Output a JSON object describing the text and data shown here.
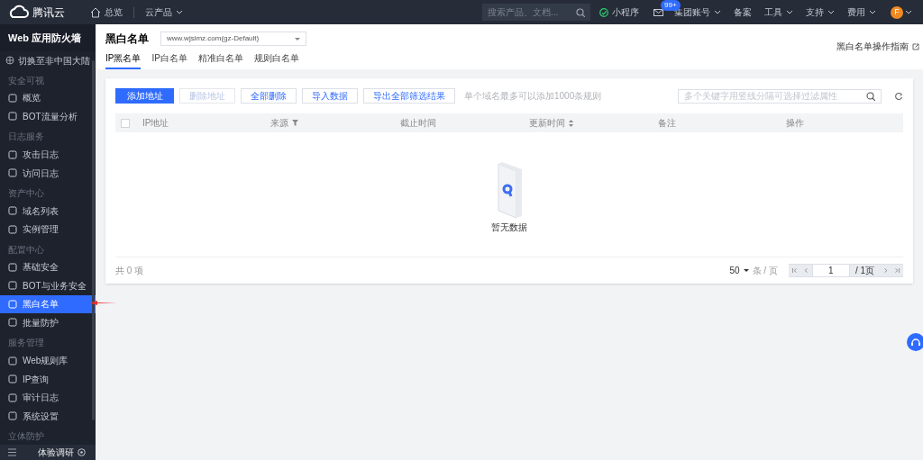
{
  "topbar": {
    "brand": "腾讯云",
    "home": "总览",
    "products": "云产品",
    "search": {
      "placeholder": "搜索产品、文档..."
    },
    "mini_program": "小程序",
    "mail_badge": "99+",
    "links": [
      {
        "label": "集团账号",
        "dropdown": true
      },
      {
        "label": "备案",
        "dropdown": false
      },
      {
        "label": "工具",
        "dropdown": true
      },
      {
        "label": "支持",
        "dropdown": true
      },
      {
        "label": "费用",
        "dropdown": true
      }
    ],
    "avatar": "F"
  },
  "sidebar": {
    "title": "Web 应用防火墙",
    "switch": "切换至非中国大陆",
    "groups": [
      {
        "label": "安全可视",
        "items": [
          {
            "label": "概览",
            "selected": false
          },
          {
            "label": "BOT流量分析",
            "selected": false
          }
        ]
      },
      {
        "label": "日志服务",
        "items": [
          {
            "label": "攻击日志",
            "selected": false
          },
          {
            "label": "访问日志",
            "selected": false
          }
        ]
      },
      {
        "label": "资产中心",
        "items": [
          {
            "label": "域名列表",
            "selected": false
          },
          {
            "label": "实例管理",
            "selected": false
          }
        ]
      },
      {
        "label": "配置中心",
        "items": [
          {
            "label": "基础安全",
            "selected": false
          },
          {
            "label": "BOT与业务安全",
            "selected": false
          },
          {
            "label": "黑白名单",
            "selected": true
          },
          {
            "label": "批量防护",
            "selected": false
          }
        ]
      },
      {
        "label": "服务管理",
        "items": [
          {
            "label": "Web规则库",
            "selected": false
          },
          {
            "label": "IP查询",
            "selected": false
          },
          {
            "label": "审计日志",
            "selected": false
          },
          {
            "label": "系统设置",
            "selected": false
          }
        ]
      },
      {
        "label": "立体防护"
      }
    ],
    "footer": "体验调研"
  },
  "header": {
    "title": "黑白名单",
    "domain_select": "www.wjsimz.com(gz-Default)",
    "guide_link": "黑白名单操作指南"
  },
  "tabs": [
    {
      "label": "IP黑名单",
      "selected": true
    },
    {
      "label": "IP白名单",
      "selected": false
    },
    {
      "label": "精准白名单",
      "selected": false
    },
    {
      "label": "规则白名单",
      "selected": false
    }
  ],
  "toolbar": {
    "buttons": [
      {
        "label": "添加地址",
        "kind": "primary",
        "disabled": false
      },
      {
        "label": "删除地址",
        "kind": "default",
        "disabled": true
      },
      {
        "label": "全部删除",
        "kind": "default",
        "disabled": false
      },
      {
        "label": "导入数据",
        "kind": "default",
        "disabled": false
      },
      {
        "label": "导出全部筛选结果",
        "kind": "default",
        "disabled": false
      }
    ],
    "hint": "单个域名最多可以添加1000条规则",
    "search": {
      "placeholder": "多个关键字用竖线分隔可选择过滤属性"
    }
  },
  "table": {
    "select_all": {
      "checked": false
    },
    "columns": [
      {
        "label": "IP地址",
        "kind": "plain"
      },
      {
        "label": "来源",
        "kind": "filter"
      },
      {
        "label": "截止时间",
        "kind": "plain"
      },
      {
        "label": "更新时间",
        "kind": "sort"
      },
      {
        "label": "备注",
        "kind": "plain"
      },
      {
        "label": "操作",
        "kind": "plain"
      }
    ],
    "empty_text": "暂无数据"
  },
  "pagination": {
    "total": "共 0 项",
    "page_size": "50",
    "per_page": "条 / 页",
    "page": "1",
    "page_total": "/ 1页"
  }
}
